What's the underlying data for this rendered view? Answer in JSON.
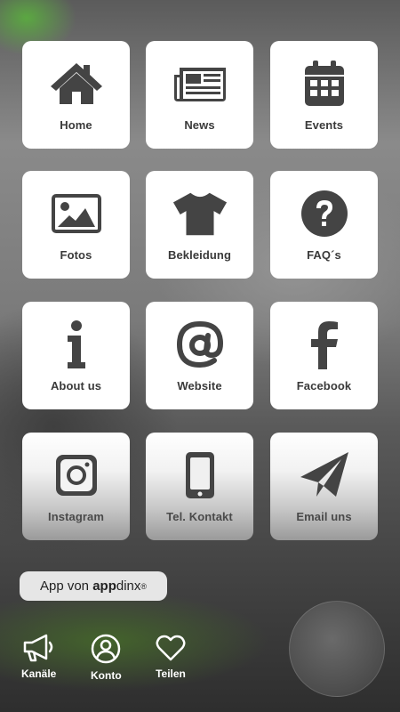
{
  "tiles": [
    {
      "label": "Home",
      "icon": "home-icon"
    },
    {
      "label": "News",
      "icon": "newspaper-icon"
    },
    {
      "label": "Events",
      "icon": "calendar-icon"
    },
    {
      "label": "Fotos",
      "icon": "image-icon"
    },
    {
      "label": "Bekleidung",
      "icon": "tshirt-icon"
    },
    {
      "label": "FAQ´s",
      "icon": "question-circle-icon"
    },
    {
      "label": "About us",
      "icon": "info-icon"
    },
    {
      "label": "Website",
      "icon": "at-sign-icon"
    },
    {
      "label": "Facebook",
      "icon": "facebook-icon"
    },
    {
      "label": "Instagram",
      "icon": "instagram-icon"
    },
    {
      "label": "Tel. Kontakt",
      "icon": "phone-icon"
    },
    {
      "label": "Email uns",
      "icon": "paper-plane-icon"
    }
  ],
  "app_badge": {
    "prefix": "App von ",
    "brand": "app",
    "brand_rest": "dinx",
    "reg": "®"
  },
  "nav": {
    "channels_label": "Kanäle",
    "account_label": "Konto",
    "share_label": "Teilen"
  },
  "colors": {
    "icon": "#444444",
    "tile_bg": "#ffffff",
    "nav_text": "#ffffff"
  }
}
